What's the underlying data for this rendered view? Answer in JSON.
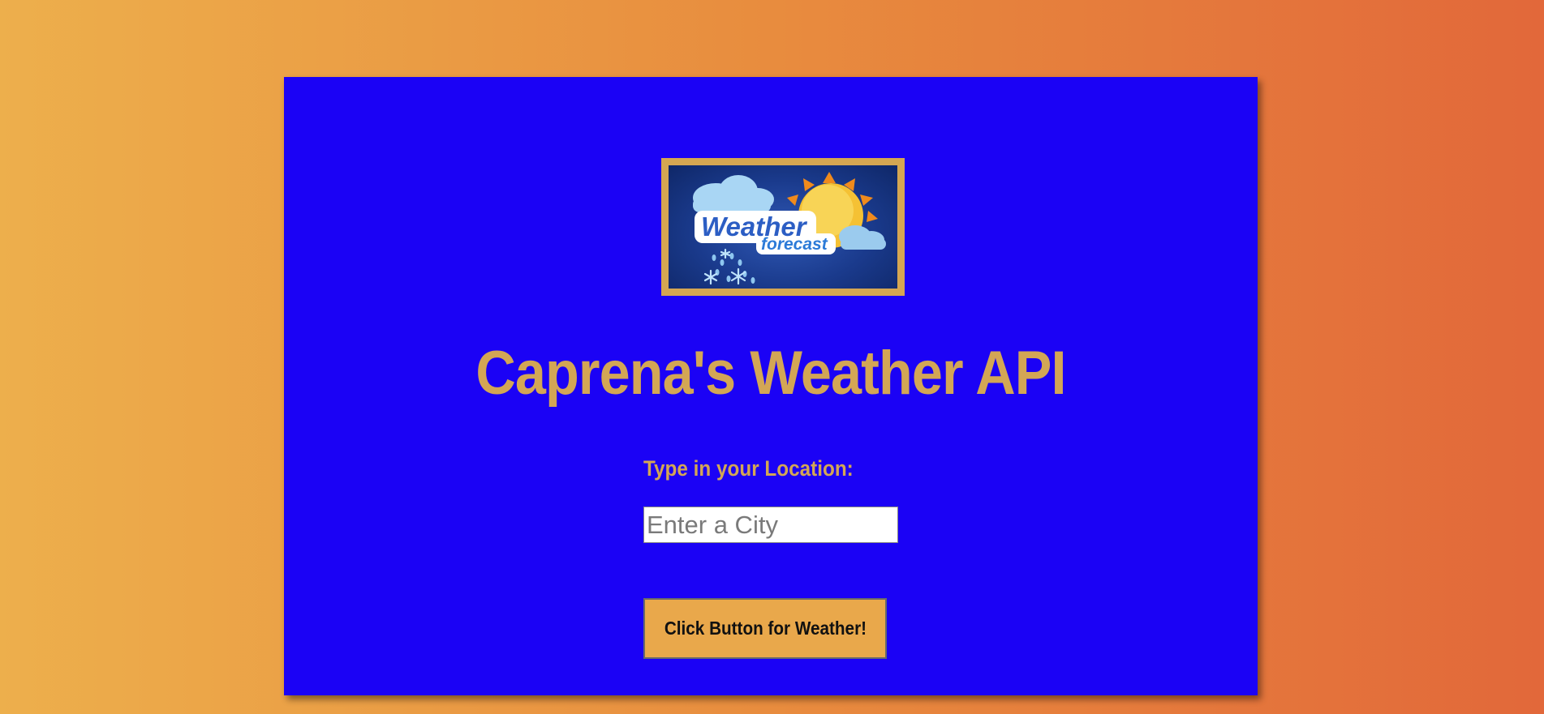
{
  "header": {
    "title": "Caprena's Weather API"
  },
  "logo": {
    "icon": "weather-forecast-logo",
    "word_main": "Weather",
    "word_sub": "forecast"
  },
  "form": {
    "location_label": "Type in your Location:",
    "city_placeholder": "Enter a City",
    "city_value": "",
    "submit_label": "Click Button for Weather!"
  },
  "colors": {
    "card": "#1b02f5",
    "accent_gold": "#d3a655",
    "button": "#e9a84b",
    "background_left": "#edaf4c",
    "background_right": "#e2683a"
  }
}
